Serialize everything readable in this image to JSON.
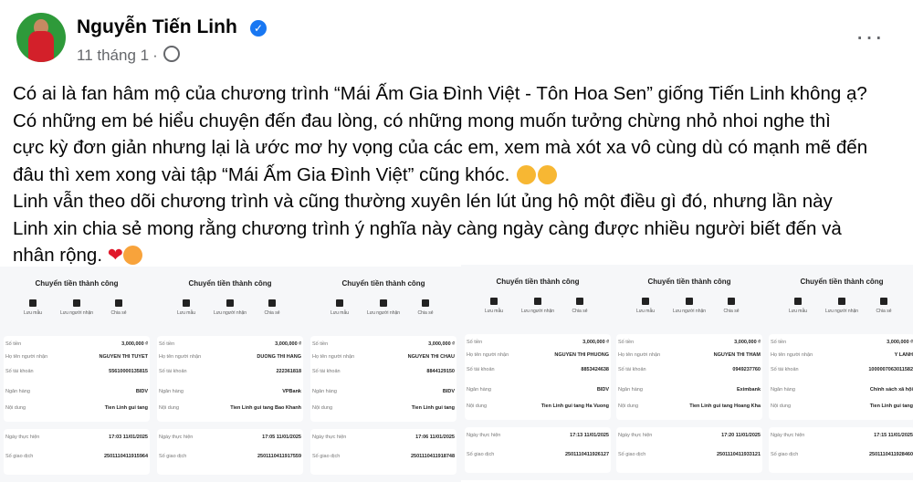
{
  "post": {
    "author": "Nguyễn Tiến Linh",
    "time": "11 tháng 1",
    "dot": "·",
    "more": "···",
    "paragraph1_lines": [
      "Có ai là fan hâm mộ của chương trình “Mái Ấm Gia Đình Việt - Tôn Hoa Sen” giống Tiến Linh không ạ?",
      "Có những em bé hiểu chuyện đến đau lòng, có những mong muốn tưởng chừng nhỏ nhoi nghe thì",
      "cực kỳ đơn giản nhưng lại là ước mơ hy vọng của các em, xem mà xót xa vô cùng dù có mạnh mẽ đến",
      "đâu thì xem xong vài tập “Mái Ấm Gia Đình Việt” cũng khóc."
    ],
    "paragraph2_lines": [
      "Linh vẫn theo dõi chương trình và cũng thường xuyên lén lút ủng hộ một điều gì đó, nhưng lần này",
      "Linh xin chia sẻ mong rằng chương trình ý nghĩa này càng ngày càng được nhiều người biết đến và",
      "nhân rộng."
    ],
    "heart": "❤"
  },
  "receipt_labels": {
    "title": "Chuyển tiền thành công",
    "save": "Lưu mẫu",
    "save_recipient": "Lưu người nhận",
    "share": "Chia sẻ",
    "amount": "Số tiền",
    "recipient": "Họ tên người nhận",
    "account": "Số tài khoản",
    "bank": "Ngân hàng",
    "content": "Nội dung",
    "date": "Ngày thực hiện",
    "transaction": "Số giao dịch"
  },
  "receipts": [
    {
      "amount": "3,000,000 ₫",
      "recipient": "NGUYEN THI TUYET",
      "account": "55610000135815",
      "bank": "BIDV",
      "content": "Tien Linh gui tang",
      "date": "17:03 11/01/2025",
      "transaction": "2501110411915964"
    },
    {
      "amount": "3,000,000 ₫",
      "recipient": "DUONG THI HANG",
      "account": "222361818",
      "bank": "VPBank",
      "content": "Tien Linh gui tang Bao Khanh",
      "date": "17:05 11/01/2025",
      "transaction": "2501110411917559"
    },
    {
      "amount": "3,000,000 ₫",
      "recipient": "NGUYEN THI CHAU",
      "account": "8844129150",
      "bank": "BIDV",
      "content": "Tien Linh gui tang",
      "date": "17:06 11/01/2025",
      "transaction": "2501110411918748"
    },
    {
      "amount": "3,000,000 ₫",
      "recipient": "NGUYEN THI PHUONG",
      "account": "8853424638",
      "bank": "BIDV",
      "content": "Tien Linh gui tang Ha Vuong",
      "date": "17:13 11/01/2025",
      "transaction": "2501110411926127"
    },
    {
      "amount": "3,000,000 ₫",
      "recipient": "NGUYEN THI THAM",
      "account": "0949237760",
      "bank": "Eximbank",
      "content": "Tien Linh gui tang Hoang Kha",
      "date": "17:20 11/01/2025",
      "transaction": "2501110411933121"
    },
    {
      "amount": "3,000,000 ₫",
      "recipient": "Y LANH",
      "account": "1000007063011582",
      "bank": "Chính sách xã hội",
      "content": "Tien Linh gui tang",
      "date": "17:15 11/01/2025",
      "transaction": "2501110411928460"
    }
  ]
}
